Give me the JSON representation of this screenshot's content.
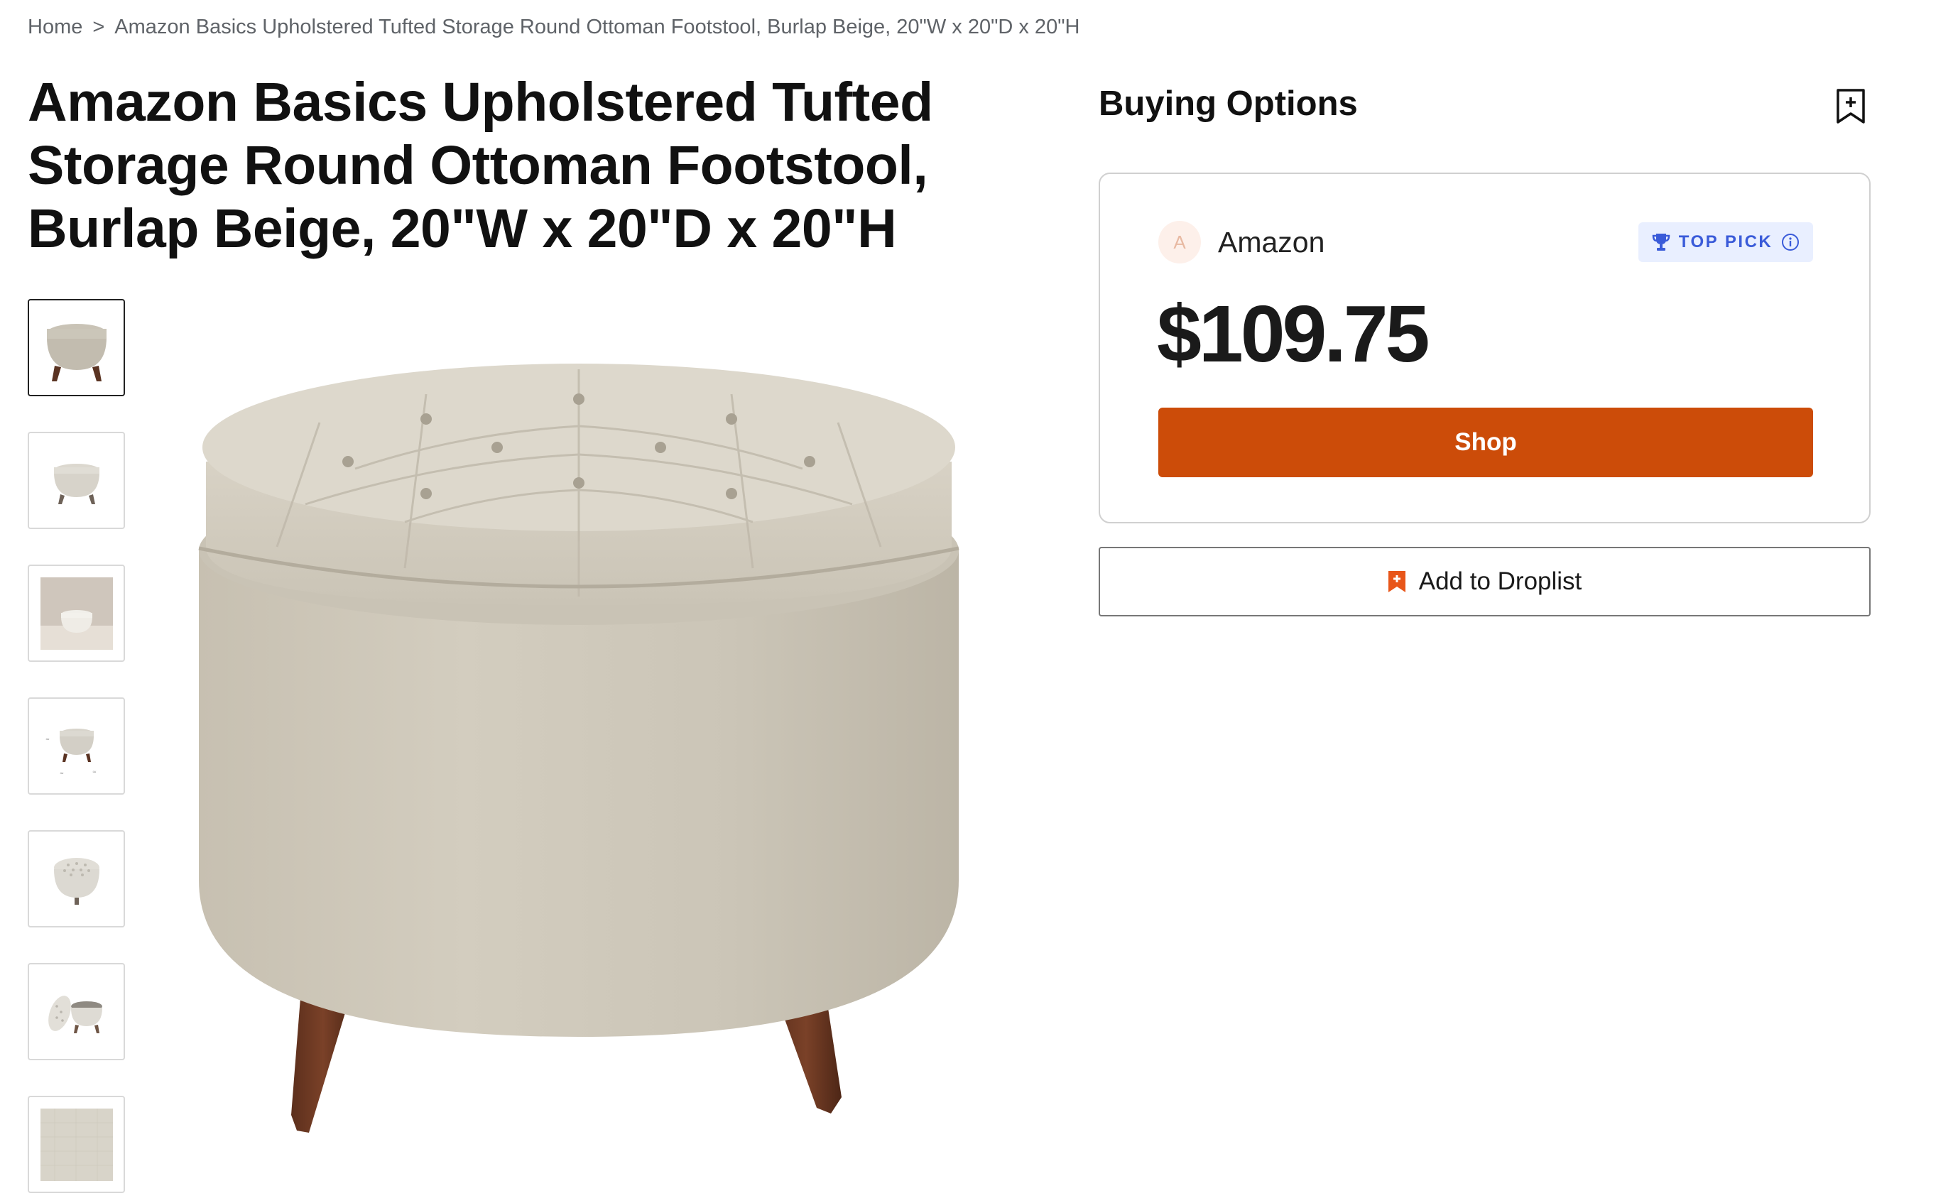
{
  "breadcrumb": {
    "home": "Home",
    "separator": ">",
    "current": "Amazon Basics Upholstered Tufted Storage Round Ottoman Footstool, Burlap Beige, 20\"W x 20\"D x 20\"H"
  },
  "product": {
    "title": "Amazon Basics Upholstered Tufted Storage Round Ottoman Footstool, Burlap Beige, 20\"W x 20\"D x 20\"H"
  },
  "gallery": {
    "thumbnails": [
      "front view",
      "front view small",
      "lifestyle room",
      "with dimensions",
      "top view",
      "open lid",
      "fabric swatch"
    ],
    "active_index": 0
  },
  "buying_options": {
    "header": "Buying Options",
    "merchant_initial": "A",
    "merchant_name": "Amazon",
    "badge": "TOP PICK",
    "price": "$109.75",
    "shop_label": "Shop",
    "droplist_label": "Add to Droplist"
  },
  "colors": {
    "shop_button": "#cc4c09",
    "badge_bg": "#e9efff",
    "badge_text": "#3a5bd9",
    "droplist_icon": "#e8561a"
  }
}
